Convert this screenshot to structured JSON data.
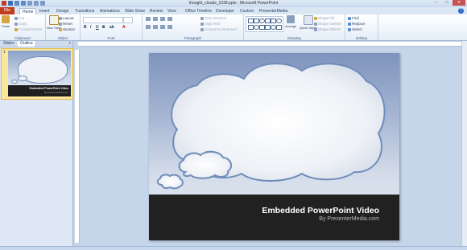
{
  "window": {
    "title": "thought_clouds_1038.pptx - Microsoft PowerPoint",
    "controls": [
      "–",
      "□",
      "✕"
    ]
  },
  "tabs": [
    {
      "label": "File"
    },
    {
      "label": "Home"
    },
    {
      "label": "Insert"
    },
    {
      "label": "Design"
    },
    {
      "label": "Transitions"
    },
    {
      "label": "Animations"
    },
    {
      "label": "Slide Show"
    },
    {
      "label": "Review"
    },
    {
      "label": "View"
    },
    {
      "label": "Office Timeline"
    },
    {
      "label": "Developer"
    },
    {
      "label": "Custom"
    },
    {
      "label": "PresenterMedia"
    }
  ],
  "ribbon": {
    "clipboard": {
      "label": "Clipboard",
      "paste": "Paste",
      "cut": "Cut",
      "copy": "Copy",
      "format_painter": "Format Painter"
    },
    "slides": {
      "label": "Slides",
      "new_slide": "New Slide",
      "layout": "Layout",
      "reset": "Reset",
      "section": "Section"
    },
    "font": {
      "label": "Font"
    },
    "paragraph": {
      "label": "Paragraph",
      "text_direction": "Text Direction",
      "align_text": "Align Text",
      "convert_smartart": "Convert to SmartArt"
    },
    "drawing": {
      "label": "Drawing",
      "arrange": "Arrange",
      "quick_styles": "Quick Styles",
      "shape_fill": "Shape Fill",
      "shape_outline": "Shape Outline",
      "shape_effects": "Shape Effects"
    },
    "editing": {
      "label": "Editing",
      "find": "Find",
      "replace": "Replace",
      "select": "Select"
    }
  },
  "panel": {
    "tabs": [
      "Slides",
      "Outline"
    ],
    "close": "×",
    "slide_number": "1"
  },
  "slide": {
    "title": "Embedded PowerPoint Video",
    "subtitle": "By PresenterMedia.com"
  },
  "colors": {
    "file_tab": "#c03d1d",
    "slide_band": "#212121",
    "cloud_border": "#6f8dbb"
  }
}
